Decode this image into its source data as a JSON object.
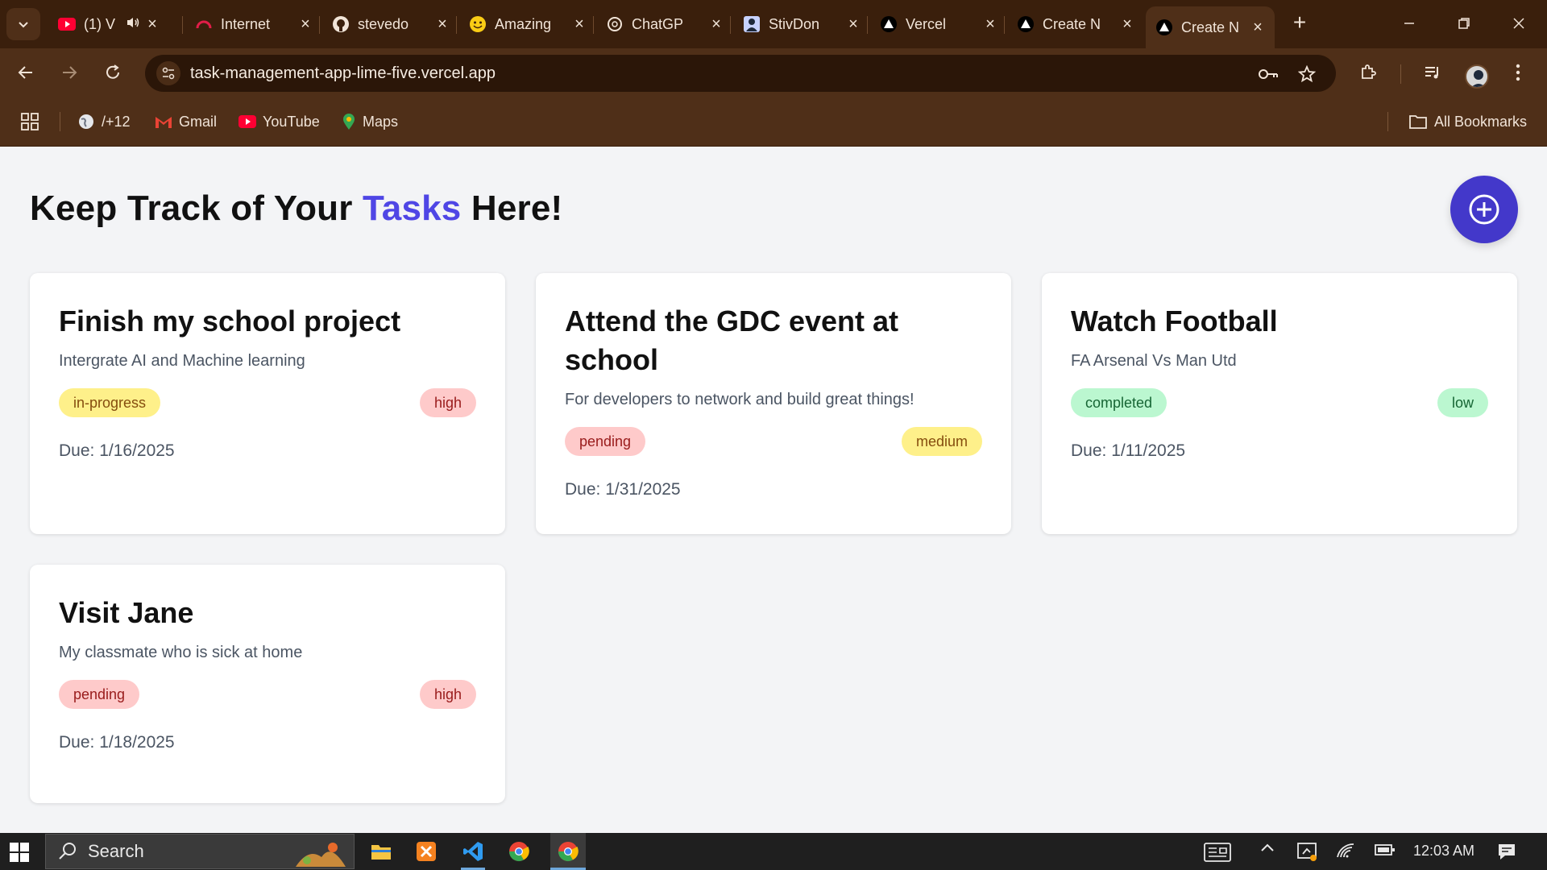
{
  "browser": {
    "tabs": [
      {
        "title": "(1) V",
        "favicon": "youtube-icon"
      },
      {
        "title": "Internet",
        "favicon": "speed-icon"
      },
      {
        "title": "stevedo",
        "favicon": "github-icon"
      },
      {
        "title": "Amazing",
        "favicon": "smiley-icon"
      },
      {
        "title": "ChatGP",
        "favicon": "chatgpt-icon"
      },
      {
        "title": "StivDon",
        "favicon": "profile-icon"
      },
      {
        "title": "Vercel",
        "favicon": "vercel-icon"
      },
      {
        "title": "Create N",
        "favicon": "vercel-icon"
      },
      {
        "title": "Create N",
        "favicon": "vercel-icon"
      }
    ],
    "url": "task-management-app-lime-five.vercel.app",
    "bookmarks": {
      "more_label": "/+12",
      "gmail": "Gmail",
      "youtube": "YouTube",
      "maps": "Maps",
      "all": "All Bookmarks"
    }
  },
  "page": {
    "heading_prefix": "Keep Track of Your ",
    "heading_accent": "Tasks",
    "heading_suffix": " Here!",
    "add_button_icon": "plus-circle-icon",
    "colors": {
      "accent": "#4f46e5",
      "fab": "#4338ca"
    },
    "tasks": [
      {
        "title": "Finish my school project",
        "description": "Intergrate AI and Machine learning",
        "status": "in-progress",
        "priority": "high",
        "due": "Due: 1/16/2025"
      },
      {
        "title": "Attend the GDC event at school",
        "description": "For developers to network and build great things!",
        "status": "pending",
        "priority": "medium",
        "due": "Due: 1/31/2025"
      },
      {
        "title": "Watch Football",
        "description": "FA Arsenal Vs Man Utd",
        "status": "completed",
        "priority": "low",
        "due": "Due: 1/11/2025"
      },
      {
        "title": "Visit Jane",
        "description": "My classmate who is sick at home",
        "status": "pending",
        "priority": "high",
        "due": "Due: 1/18/2025"
      }
    ]
  },
  "taskbar": {
    "search_label": "Search",
    "time": "12:03 AM"
  }
}
